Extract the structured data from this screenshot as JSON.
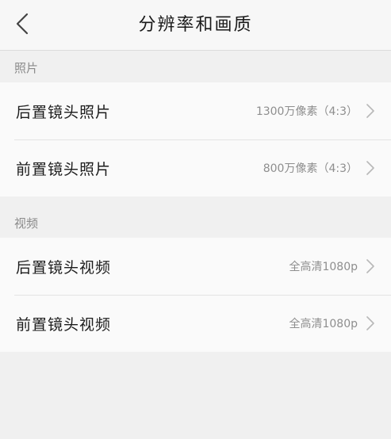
{
  "header": {
    "title": "分辨率和画质",
    "back_icon": "chevron-left-icon"
  },
  "sections": [
    {
      "title": "照片",
      "items": [
        {
          "label": "后置镜头照片",
          "value": "1300万像素（4:3）",
          "icon": "chevron-right-icon"
        },
        {
          "label": "前置镜头照片",
          "value": "800万像素（4:3）",
          "icon": "chevron-right-icon"
        }
      ]
    },
    {
      "title": "视频",
      "items": [
        {
          "label": "后置镜头视频",
          "value": "全高清1080p",
          "icon": "chevron-right-icon"
        },
        {
          "label": "前置镜头视频",
          "value": "全高清1080p",
          "icon": "chevron-right-icon"
        }
      ]
    }
  ],
  "colors": {
    "background": "#f0f0f0",
    "row_background": "#fafafa",
    "secondary_text": "#8e8e8e",
    "divider": "#e4e4e4"
  }
}
